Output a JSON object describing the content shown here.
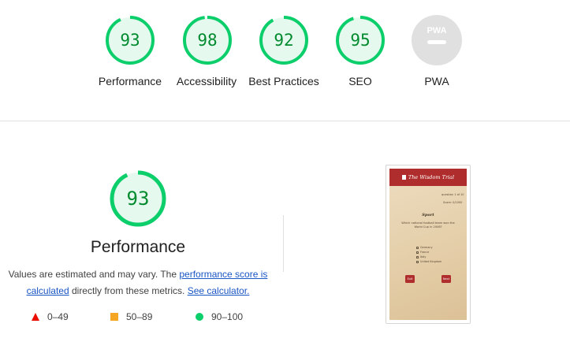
{
  "categories": [
    {
      "score": 93,
      "label": "Performance",
      "fraction": 0.93
    },
    {
      "score": 98,
      "label": "Accessibility",
      "fraction": 0.98
    },
    {
      "score": 92,
      "label": "Best Practices",
      "fraction": 0.92
    },
    {
      "score": 95,
      "label": "SEO",
      "fraction": 0.95
    },
    {
      "label": "PWA",
      "badge": "PWA"
    }
  ],
  "performance": {
    "score": 93,
    "fraction": 0.93,
    "title": "Performance",
    "desc_part1": "Values are estimated and may vary. The ",
    "desc_link1": "performance score is calculated",
    "desc_part2": " directly from these metrics. ",
    "desc_link2": "See calculator."
  },
  "legend": [
    {
      "shape": "triangle",
      "range": "0–49",
      "color": "#eb0f00"
    },
    {
      "shape": "square",
      "range": "50–89",
      "color": "#f5a623"
    },
    {
      "shape": "circle",
      "range": "90–100",
      "color": "#0cce6b"
    }
  ],
  "colors": {
    "pass_ring": "#0cce6b",
    "pass_fill": "#e6f9ee",
    "pass_text": "#008a2e",
    "pwa_grey": "#e0e0e0"
  },
  "screenshot": {
    "app_title": "The Wisdom Trial",
    "question_counter": "question 1 of 10",
    "score_text": "Score: 0/1000",
    "category": "Sport",
    "question": "Which national football team won the World Cup in 2006?",
    "options": [
      "Germany",
      "France",
      "Italy",
      "United Kingdom"
    ],
    "btn_left": "Exit",
    "btn_right": "Next"
  }
}
